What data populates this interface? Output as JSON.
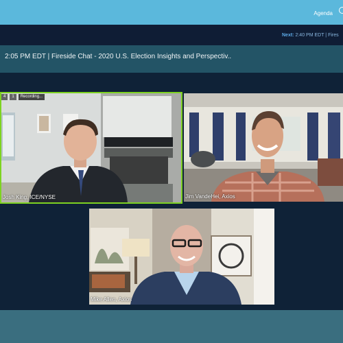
{
  "header": {
    "agenda_label": "Agenda"
  },
  "next_bar": {
    "next_label": "Next:",
    "next_text": "2:40 PM EDT | Fires"
  },
  "session": {
    "title": "2:05 PM EDT | Fireside Chat - 2020 U.S. Election Insights and Perspectiv.."
  },
  "video": {
    "stats": {
      "participants": "4",
      "chat": "1",
      "recording_label": "Recording..."
    },
    "participants": [
      {
        "name": "Josh King, ICE/NYSE",
        "active_speaker": true
      },
      {
        "name": "Jim VandeHei, Axios"
      },
      {
        "name": "Mike Allen, Axios"
      }
    ]
  },
  "colors": {
    "topbar": "#5bb8dc",
    "next_bar": "#0f1d35",
    "title_bar": "#235466",
    "stage": "#0f2237",
    "active_speaker_border": "#7ed321"
  }
}
